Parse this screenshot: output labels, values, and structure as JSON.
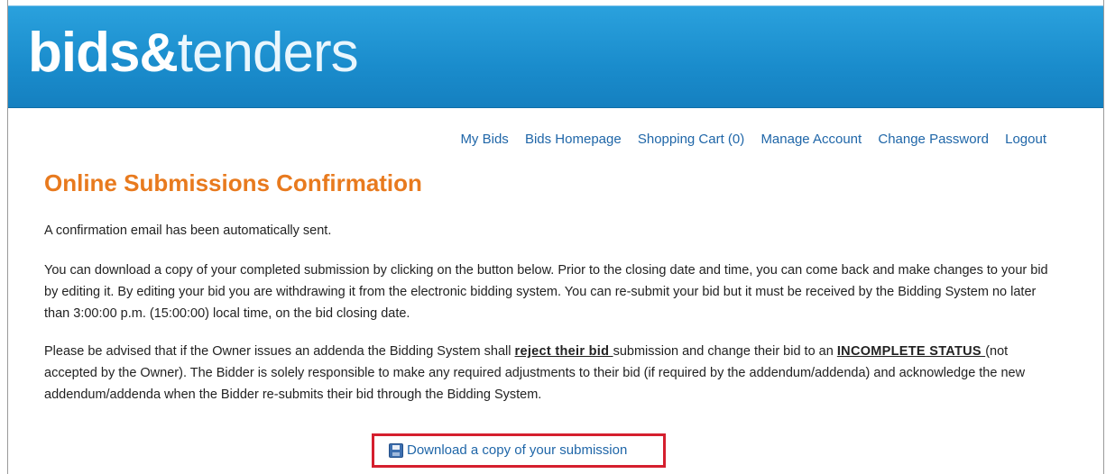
{
  "logo": {
    "part1": "bids",
    "amp": "&",
    "part2": "tenders"
  },
  "nav": {
    "items": [
      {
        "label": "My Bids"
      },
      {
        "label": "Bids Homepage"
      },
      {
        "label": "Shopping Cart (0)"
      },
      {
        "label": "Manage Account"
      },
      {
        "label": "Change Password"
      },
      {
        "label": "Logout"
      }
    ]
  },
  "page": {
    "title": "Online Submissions Confirmation",
    "para1": "A confirmation email has been automatically sent.",
    "para2": "You can download a copy of your completed submission by clicking on the button below. Prior to the closing date and time, you can come back and make changes to your bid by editing it. By editing your bid you are withdrawing it from the electronic bidding system. You can re-submit your bid but it must be received by the Bidding System no later than 3:00:00 p.m. (15:00:00) local time, on the bid closing date.",
    "para3": {
      "a": "Please be advised that if the Owner issues an addenda the Bidding System shall ",
      "b": "reject their bid ",
      "c": "submission and change their bid to an ",
      "d": "INCOMPLETE STATUS ",
      "e": "(not accepted by the Owner). The Bidder is solely responsible to make any required adjustments to their bid (if required by the addendum/addenda) and acknowledge the new addendum/addenda when the Bidder re-submits their bid through the Bidding System."
    },
    "download_label": "Download a copy of your submission",
    "download_icon": "save-icon"
  },
  "colors": {
    "banner": "#1a8ccc",
    "title": "#e87a1e",
    "link": "#1f66a8",
    "highlight_border": "#d51f2e"
  }
}
